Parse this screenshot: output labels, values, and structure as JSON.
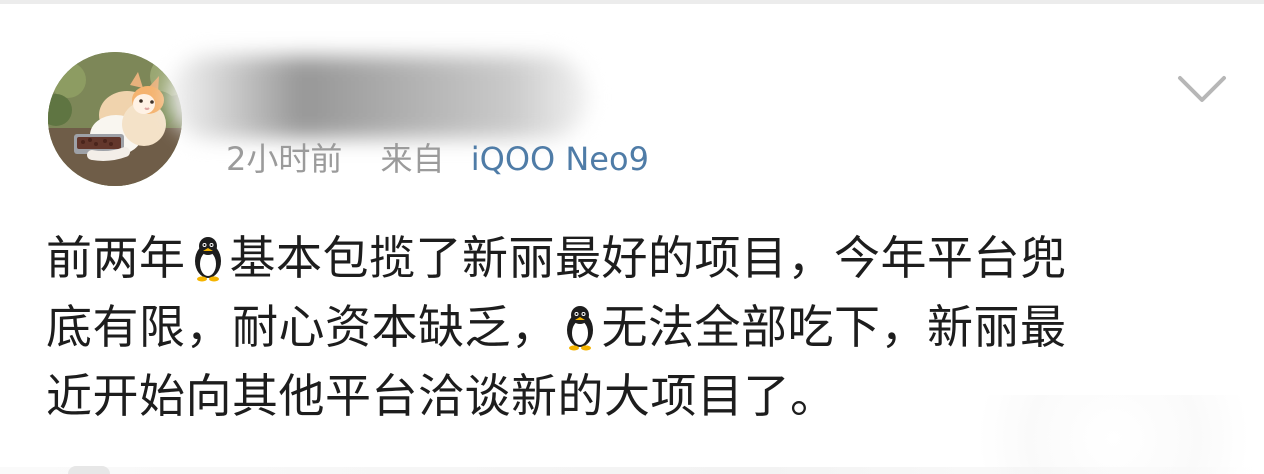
{
  "post": {
    "avatar_icon": "cat-avatar-icon",
    "username": "",
    "time": "2小时前",
    "from_label": "来自",
    "device": "iQOO Neo9",
    "menu_icon": "chevron-down-icon",
    "emoji_icon": "penguin-icon",
    "content_lines": [
      {
        "before": "前两年",
        "after": "基本包揽了新丽最好的项目，今年平台兜"
      },
      {
        "before": "底有限，耐心资本缺乏，",
        "after": "无法全部吃下，新丽最"
      },
      {
        "before": "近开始向其他平台洽谈新的大项目了。",
        "after": ""
      }
    ]
  },
  "colors": {
    "time_text": "#9b9b9b",
    "device_text": "#4f7ca7",
    "content_text": "#1d1d1d"
  }
}
